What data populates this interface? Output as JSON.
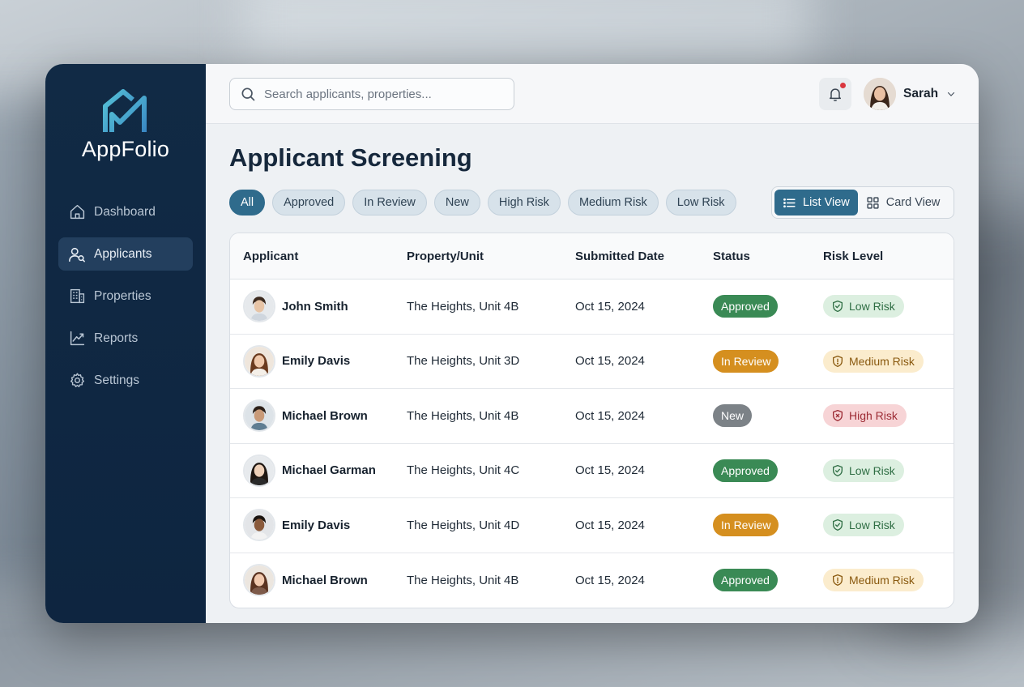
{
  "app": {
    "name": "AppFolio"
  },
  "sidebar": {
    "items": [
      {
        "label": "Dashboard",
        "icon": "home-icon",
        "active": false
      },
      {
        "label": "Applicants",
        "icon": "user-search-icon",
        "active": true
      },
      {
        "label": "Properties",
        "icon": "building-icon",
        "active": false
      },
      {
        "label": "Reports",
        "icon": "trend-chart-icon",
        "active": false
      },
      {
        "label": "Settings",
        "icon": "gear-icon",
        "active": false
      }
    ]
  },
  "header": {
    "search_placeholder": "Search applicants, properties...",
    "user_name": "Sarah",
    "notification_dot": true
  },
  "page": {
    "title": "Applicant Screening",
    "filters": [
      "All",
      "Approved",
      "In Review",
      "New",
      "High Risk",
      "Medium Risk",
      "Low Risk"
    ],
    "active_filter": "All",
    "view_toggle": {
      "list_label": "List View",
      "card_label": "Card View",
      "active": "List View"
    }
  },
  "table": {
    "columns": [
      "Applicant",
      "Property/Unit",
      "Submitted Date",
      "Status",
      "Risk Level"
    ],
    "rows": [
      {
        "name": "John Smith",
        "property": "The Heights, Unit 4B",
        "date": "Oct 15, 2024",
        "status": "Approved",
        "risk": "Low Risk"
      },
      {
        "name": "Emily Davis",
        "property": "The Heights, Unit 3D",
        "date": "Oct 15, 2024",
        "status": "In Review",
        "risk": "Medium Risk"
      },
      {
        "name": "Michael Brown",
        "property": "The Heights, Unit 4B",
        "date": "Oct 15, 2024",
        "status": "New",
        "risk": "High Risk"
      },
      {
        "name": "Michael Garman",
        "property": "The Heights, Unit 4C",
        "date": "Oct 15, 2024",
        "status": "Approved",
        "risk": "Low Risk"
      },
      {
        "name": "Emily Davis",
        "property": "The Heights, Unit 4D",
        "date": "Oct 15, 2024",
        "status": "In Review",
        "risk": "Low Risk"
      },
      {
        "name": "Michael Brown",
        "property": "The Heights, Unit 4B",
        "date": "Oct 15, 2024",
        "status": "Approved",
        "risk": "Medium Risk"
      }
    ]
  },
  "colors": {
    "sidebar_bg": "#112a45",
    "accent": "#2f6b8c",
    "status_approved": "#3a8a55",
    "status_in_review": "#d58f1f",
    "status_new": "#7c8287",
    "risk_low_bg": "#dcefe0",
    "risk_low_fg": "#2f6e44",
    "risk_medium_bg": "#fbeccd",
    "risk_medium_fg": "#8a5a10",
    "risk_high_bg": "#f7d4d6",
    "risk_high_fg": "#9c2a33"
  }
}
